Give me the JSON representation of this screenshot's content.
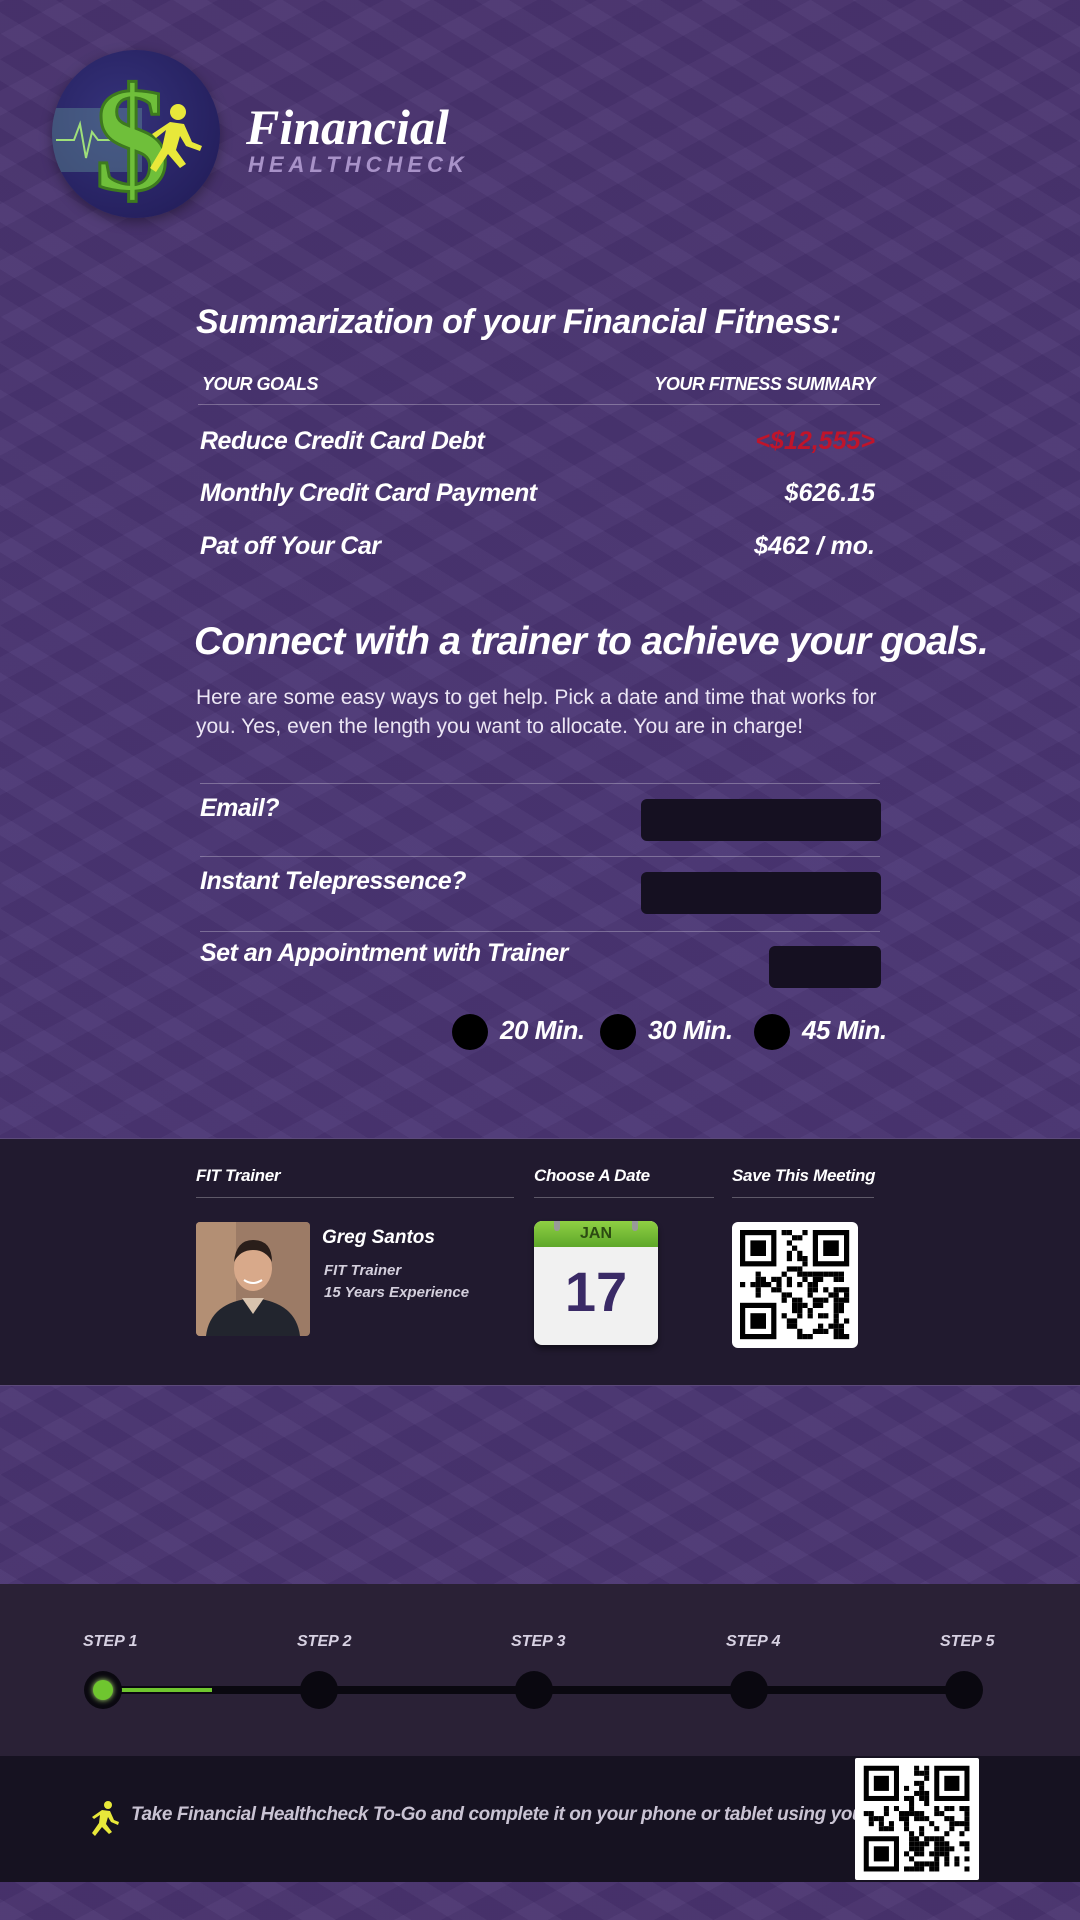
{
  "brand": {
    "title": "Financial",
    "subtitle": "HEALTHCHECK"
  },
  "summary": {
    "title": "Summarization of your Financial Fitness:",
    "col_goals": "YOUR GOALS",
    "col_summary": "YOUR FITNESS SUMMARY",
    "rows": [
      {
        "label": "Reduce Credit Card Debt",
        "value": "<$12,555>",
        "color": "#c0142a"
      },
      {
        "label": "Monthly Credit Card Payment",
        "value": "$626.15",
        "color": "#ffffff"
      },
      {
        "label": "Pat off Your Car",
        "value": "$462 / mo.",
        "color": "#ffffff"
      }
    ]
  },
  "connect": {
    "title": "Connect with a trainer to achieve your goals.",
    "description": "Here are some easy ways to get help. Pick a date and time that works for you.  Yes, even the length you want to allocate. You are in charge!",
    "email_label": "Email?",
    "email_value": "",
    "telepresence_label": "Instant Telepressence?",
    "telepresence_value": "",
    "appointment_label": "Set an Appointment with Trainer",
    "appointment_value": "",
    "durations": [
      "20 Min.",
      "30 Min.",
      "45 Min."
    ]
  },
  "trainer": {
    "head_trainer": "FIT Trainer",
    "head_date": "Choose A Date",
    "head_save": "Save This Meeting",
    "name": "Greg Santos",
    "role": "FIT Trainer",
    "experience": "15 Years Experience",
    "date_month": "JAN",
    "date_day": "17"
  },
  "steps": {
    "labels": [
      "STEP 1",
      "STEP 2",
      "STEP 3",
      "STEP 4",
      "STEP 5"
    ],
    "current": 1,
    "accent": "#6fc62f"
  },
  "footer": {
    "text": "Take Financial Healthcheck To-Go and complete it on your phone or tablet using your QR reader:"
  },
  "colors": {
    "background": "#4b3573",
    "band": "#211a2f",
    "negative": "#c0142a",
    "accent": "#6fc62f"
  }
}
